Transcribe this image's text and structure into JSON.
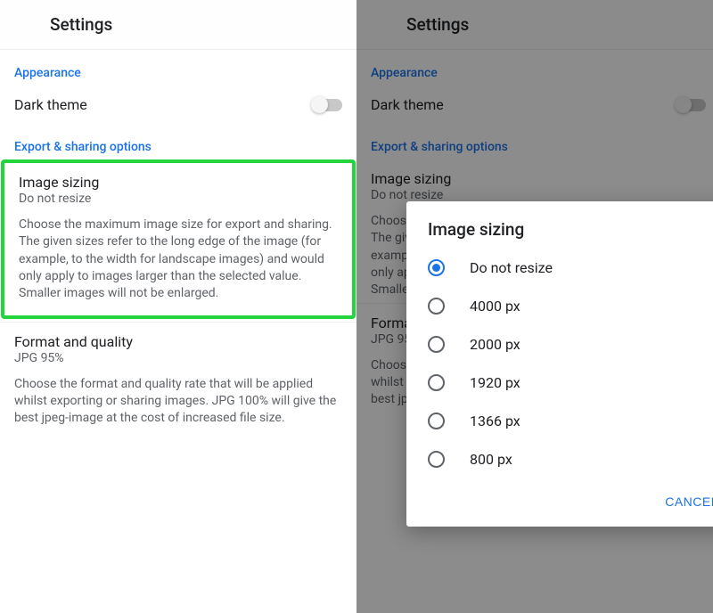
{
  "header": {
    "title": "Settings"
  },
  "sections": {
    "appearance": {
      "label": "Appearance",
      "dark_theme": "Dark theme"
    },
    "export": {
      "label": "Export & sharing options",
      "image_sizing": {
        "title": "Image sizing",
        "value": "Do not resize",
        "desc": "Choose the maximum image size for export and sharing. The given sizes refer to the long edge of the image (for example, to the width for landscape images) and would only apply to images larger than the selected value. Smaller images will not be enlarged."
      },
      "format": {
        "title": "Format and quality",
        "value": "JPG 95%",
        "desc": "Choose the format and quality rate that will be applied whilst exporting or sharing images. JPG 100% will give the best jpeg-image at the cost of increased file size."
      }
    }
  },
  "dialog": {
    "title": "Image sizing",
    "options": [
      "Do not resize",
      "4000 px",
      "2000 px",
      "1920 px",
      "1366 px",
      "800 px"
    ],
    "selected_index": 0,
    "cancel": "CANCEL"
  }
}
